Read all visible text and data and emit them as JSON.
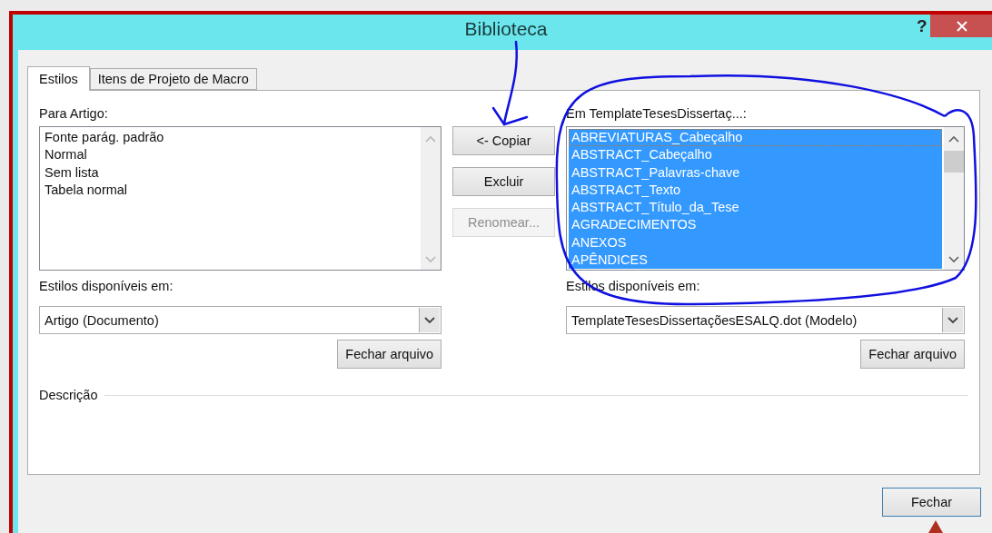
{
  "window": {
    "title": "Biblioteca",
    "help": "?"
  },
  "tabs": [
    {
      "label": "Estilos",
      "selected": true
    },
    {
      "label": "Itens de Projeto de Macro",
      "selected": false
    }
  ],
  "left": {
    "label": "Para Artigo:",
    "items": [
      {
        "text": "Fonte parág. padrão",
        "selected": false,
        "focused": false
      },
      {
        "text": "Normal",
        "selected": false,
        "focused": false
      },
      {
        "text": "Sem lista",
        "selected": false,
        "focused": false
      },
      {
        "text": "Tabela normal",
        "selected": false,
        "focused": false
      }
    ],
    "available_label": "Estilos disponíveis em:",
    "combo_value": "Artigo (Documento)",
    "close_file": "Fechar arquivo"
  },
  "middle_buttons": [
    {
      "label": "<- Copiar",
      "disabled": false
    },
    {
      "label": "Excluir",
      "disabled": false
    },
    {
      "label": "Renomear...",
      "disabled": true
    }
  ],
  "right": {
    "label": "Em TemplateTesesDissertaç...:",
    "items": [
      {
        "text": "ABREVIATURAS_Cabeçalho",
        "selected": true,
        "focused": true
      },
      {
        "text": "ABSTRACT_Cabeçalho",
        "selected": true,
        "focused": false
      },
      {
        "text": "ABSTRACT_Palavras-chave",
        "selected": true,
        "focused": false
      },
      {
        "text": "ABSTRACT_Texto",
        "selected": true,
        "focused": false
      },
      {
        "text": "ABSTRACT_Título_da_Tese",
        "selected": true,
        "focused": false
      },
      {
        "text": "AGRADECIMENTOS",
        "selected": true,
        "focused": false
      },
      {
        "text": "ANEXOS",
        "selected": true,
        "focused": false
      },
      {
        "text": "APÊNDICES",
        "selected": true,
        "focused": false
      }
    ],
    "available_label": "Estilos disponíveis em:",
    "combo_value": "TemplateTesesDissertaçõesESALQ.dot (Modelo)",
    "close_file": "Fechar arquivo"
  },
  "description_label": "Descrição",
  "footer_button": "Fechar"
}
